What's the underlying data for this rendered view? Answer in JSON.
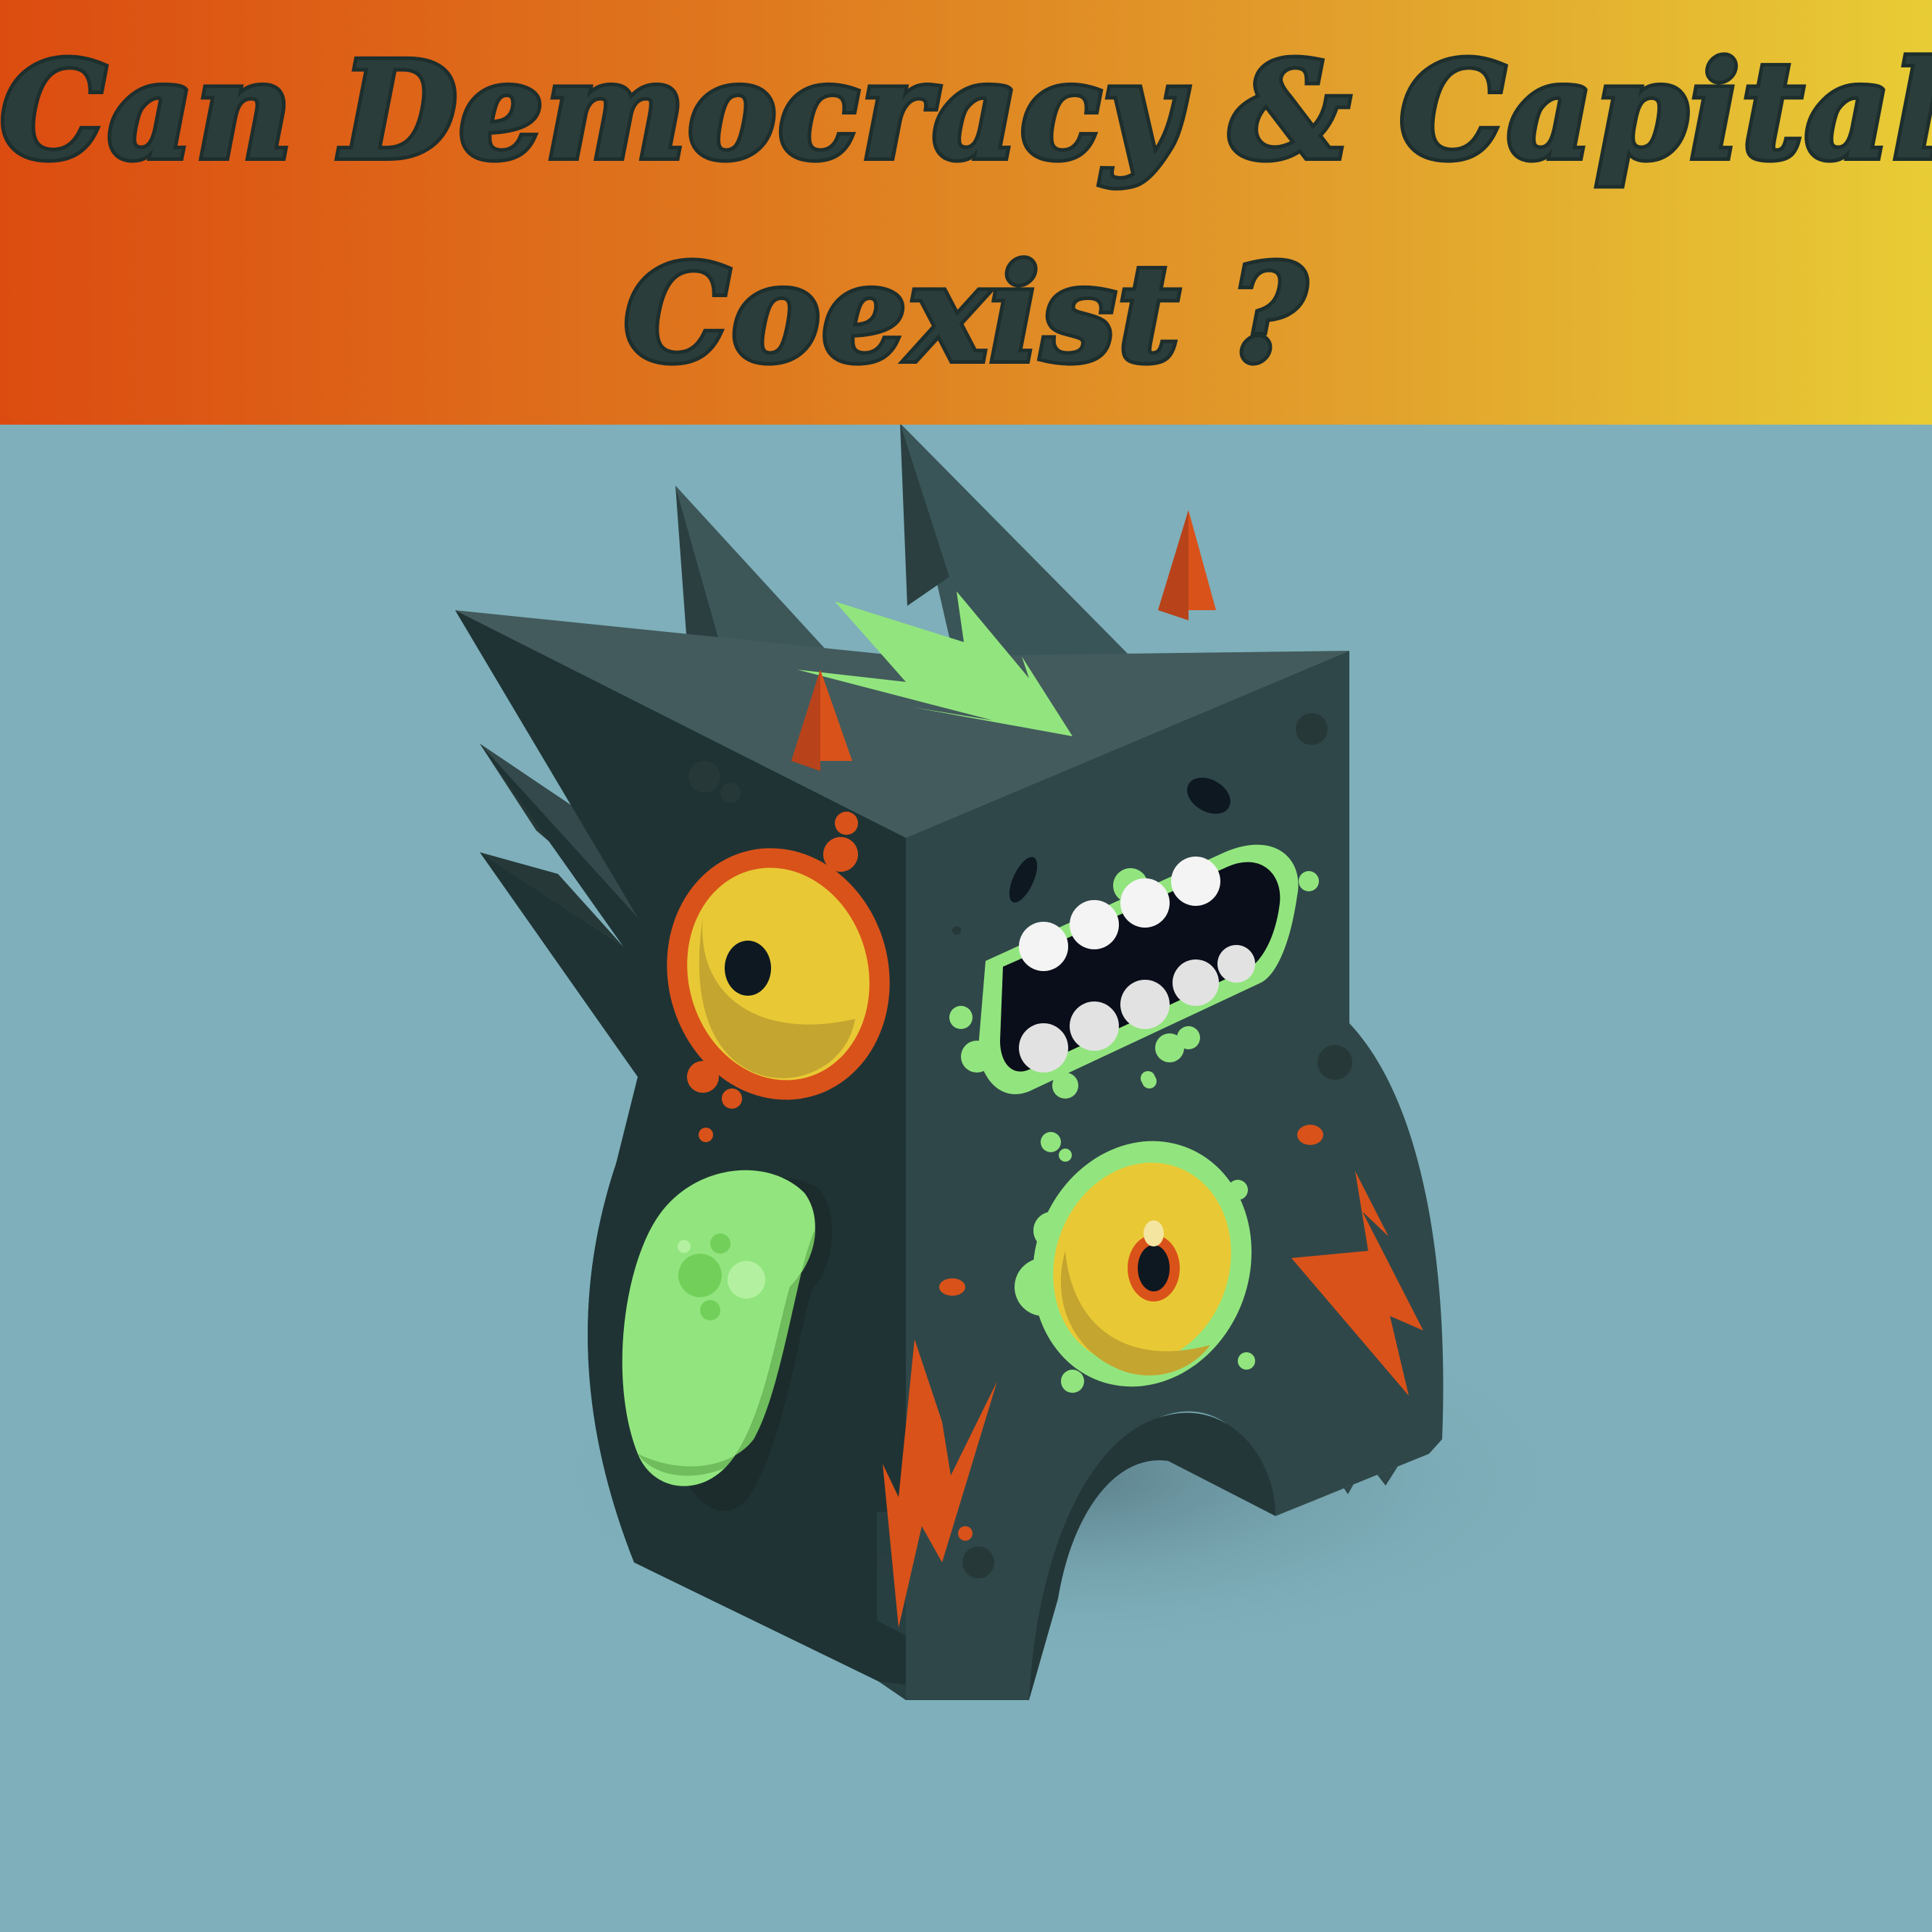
{
  "banner": {
    "title_line_1": "Can Democracy & Capitalism",
    "title_line_2": "Coexist ?"
  },
  "illustration": {
    "subject": "monster-icon"
  },
  "colors": {
    "banner_start": "#dc4c10",
    "banner_end": "#e8cc35",
    "background": "#7eafba",
    "title_text": "#2a3d3b",
    "monster_body": "#2f4749",
    "accent_green": "#92e57e",
    "accent_orange": "#d9521a",
    "eye_yellow": "#e8c935"
  }
}
